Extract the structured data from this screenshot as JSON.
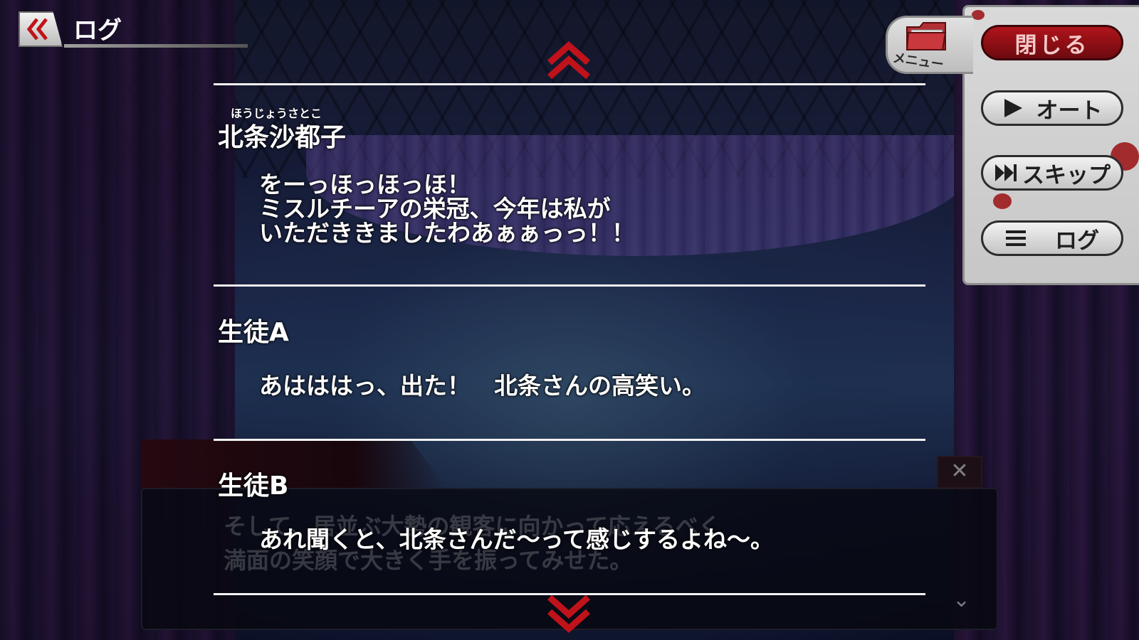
{
  "header": {
    "title": "ログ"
  },
  "menu": {
    "tab_label": "メニュー",
    "close_label": "閉じる",
    "auto_label": "オート",
    "skip_label": "スキップ",
    "log_label": "ログ"
  },
  "log_entries": [
    {
      "ruby": "ほうじょうさとこ",
      "speaker": "北条沙都子",
      "lines": [
        "をーっほっほっほ！",
        "ミスルチーアの栄冠、今年は私が",
        "いただききましたわあぁぁっっ！！"
      ]
    },
    {
      "speaker": "生徒A",
      "lines": [
        "あはははっ、出た！　北条さんの高笑い。"
      ]
    },
    {
      "speaker": "生徒B",
      "lines": [
        "あれ聞くと、北条さんだ〜って感じするよね〜。"
      ]
    }
  ],
  "background_dialogue": {
    "lines": [
      "そして、居並ぶ大勢の観客に向かって応えるべく",
      "満面の笑顔で大きく手を振ってみせた。"
    ]
  },
  "colors": {
    "accent_red": "#b0141b",
    "text": "#ffffff",
    "panel": "#d0d0d0"
  }
}
